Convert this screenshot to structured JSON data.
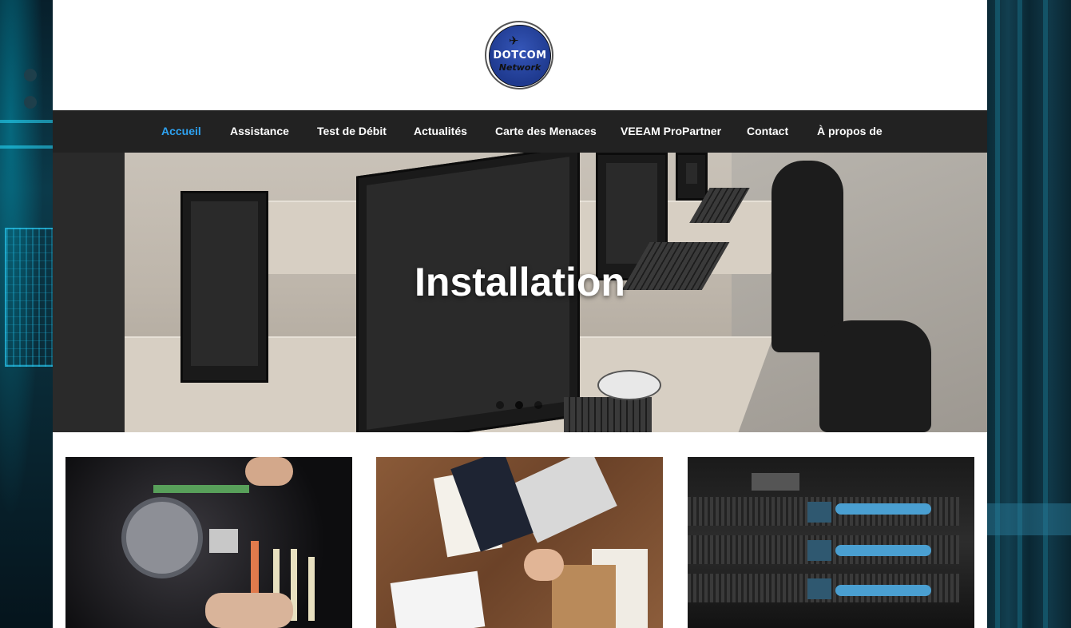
{
  "logo": {
    "title": "DOTCOM",
    "subtitle": "Network",
    "icon": "airplane-logo-icon"
  },
  "nav": {
    "items": [
      {
        "label": "Accueil",
        "active": true
      },
      {
        "label": "Assistance",
        "active": false
      },
      {
        "label": "Test de Débit",
        "active": false
      },
      {
        "label": "Actualités",
        "active": false
      },
      {
        "label": "Carte des Menaces",
        "active": false
      },
      {
        "label": "VEEAM ProPartner",
        "active": false
      },
      {
        "label": "Contact",
        "active": false
      },
      {
        "label": "À propos de",
        "active": false
      }
    ]
  },
  "hero": {
    "title": "Installation",
    "slides": 3,
    "active_slide": 2
  },
  "cards": [
    {
      "image": "motherboard-repair-photo"
    },
    {
      "image": "business-handshake-photo"
    },
    {
      "image": "server-rack-photo"
    }
  ],
  "colors": {
    "nav_background": "#222222",
    "nav_active": "#2ea3f2",
    "page_background": "#ffffff"
  }
}
